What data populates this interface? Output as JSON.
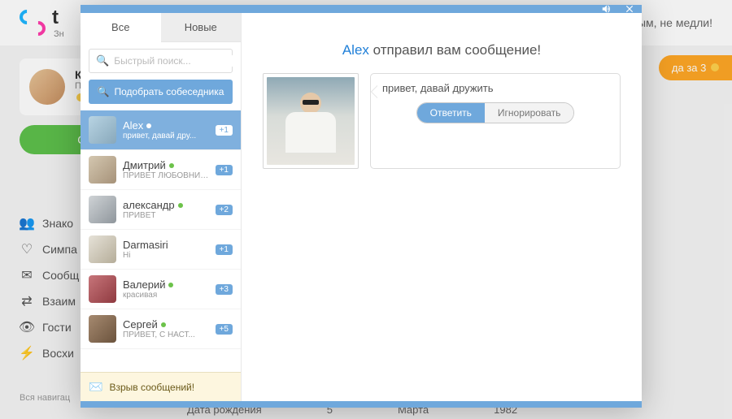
{
  "bg": {
    "logo_text": "t",
    "logo_sub": "Зн",
    "header_right": "ым, не медли!",
    "card_name": "Ка",
    "card_sub": "Пр",
    "green_btn": "Стать",
    "orange_btn": "да за 3",
    "nav": [
      "Знако",
      "Симпа",
      "Сообщ",
      "Взаим",
      "Гости",
      "Восхи"
    ],
    "footer": "Вся навигац",
    "table": {
      "label": "Дата рождения",
      "day": "5",
      "month": "Марта",
      "year": "1982"
    }
  },
  "modal": {
    "tabs": {
      "all": "Все",
      "new": "Новые"
    },
    "search_placeholder": "Быстрый поиск...",
    "match_btn": "Подобрать собеседника",
    "chats": [
      {
        "name": "Alex",
        "preview": "привет, давай дру...",
        "badge": "+1",
        "online": true,
        "selected": true,
        "ava": "av1"
      },
      {
        "name": "Дмитрий",
        "preview": "Привет любовник ...",
        "badge": "+1",
        "online": true,
        "selected": false,
        "ava": "av2"
      },
      {
        "name": "александр",
        "preview": "Привет",
        "badge": "+2",
        "online": true,
        "selected": false,
        "ava": "av3"
      },
      {
        "name": "Darmasiri",
        "preview": "Hi",
        "badge": "+1",
        "online": false,
        "selected": false,
        "ava": "av4"
      },
      {
        "name": "Валерий",
        "preview": "красивая",
        "badge": "+3",
        "online": true,
        "selected": false,
        "ava": "av5"
      },
      {
        "name": "Сергей",
        "preview": "ПРИВЕТ, С НАСТ...",
        "badge": "+5",
        "online": true,
        "selected": false,
        "ava": "av6"
      }
    ],
    "sidebar_footer": "Взрыв сообщений!",
    "main": {
      "sender": "Alex",
      "suffix": "отправил вам сообщение!",
      "message": "привет, давай дружить",
      "reply": "Ответить",
      "ignore": "Игнорировать"
    }
  }
}
